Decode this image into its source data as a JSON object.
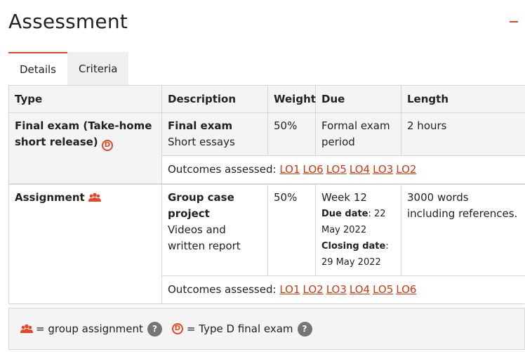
{
  "title": "Assessment",
  "tabs": [
    {
      "label": "Details",
      "active": true
    },
    {
      "label": "Criteria",
      "active": false
    }
  ],
  "table": {
    "headers": [
      "Type",
      "Description",
      "Weight",
      "Due",
      "Length"
    ],
    "rows": [
      {
        "type": "Final exam (Take-home short release)",
        "type_icon": "type-d-icon",
        "description_title": "Final exam",
        "description": "Short essays",
        "weight": "50%",
        "due": "Formal exam period",
        "length": "2 hours",
        "outcomes_label": "Outcomes assessed:",
        "outcomes": [
          "LO1",
          "LO6",
          "LO5",
          "LO4",
          "LO3",
          "LO2"
        ]
      },
      {
        "type": "Assignment",
        "type_icon": "group-icon",
        "description_title": "Group case project",
        "description": "Videos and written report",
        "weight": "50%",
        "due": "Week 12",
        "due_date_label": "Due date",
        "due_date": ": 22 May 2022",
        "closing_date_label": "Closing date",
        "closing_date": ": 29 May 2022",
        "length": "3000 words including references.",
        "outcomes_label": "Outcomes assessed:",
        "outcomes": [
          "LO1",
          "LO2",
          "LO3",
          "LO4",
          "LO5",
          "LO6"
        ]
      }
    ]
  },
  "legend": {
    "group_text": "= group assignment",
    "typed_text": "= Type D final exam",
    "help_glyph": "?"
  },
  "colors": {
    "accent": "#e64626",
    "link": "#d4380d",
    "help": "#757575"
  }
}
